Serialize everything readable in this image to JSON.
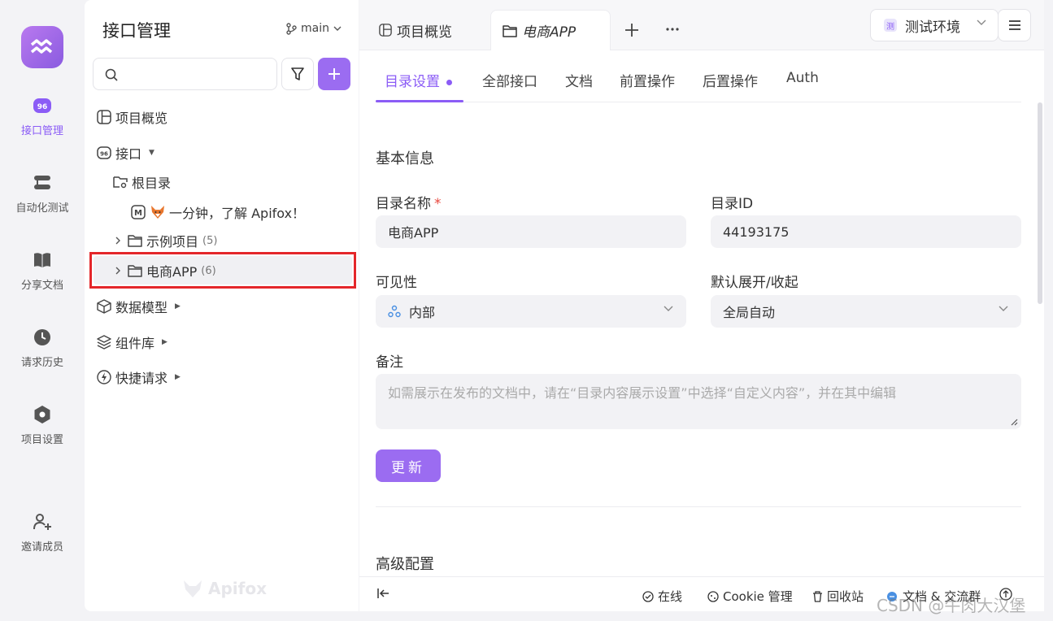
{
  "app": {
    "logo_icon": "aquarius-logo-icon",
    "brand_color": "#8b5cf6"
  },
  "rail": {
    "items": [
      {
        "label": "接口管理",
        "icon": "api-icon",
        "active": true
      },
      {
        "label": "自动化测试",
        "icon": "automation-icon"
      },
      {
        "label": "分享文档",
        "icon": "book-icon"
      },
      {
        "label": "请求历史",
        "icon": "clock-icon"
      },
      {
        "label": "项目设置",
        "icon": "hexagon-settings-icon"
      }
    ],
    "invite_label": "邀请成员"
  },
  "left_panel": {
    "title": "接口管理",
    "branch": "main",
    "search_placeholder": "",
    "tree": {
      "overview": "项目概览",
      "api": "接口",
      "root": "根目录",
      "intro_doc": "一分钟，了解 Apifox！",
      "sample_project": {
        "label": "示例项目",
        "count": "(5)"
      },
      "ecommerce": {
        "label": "电商APP",
        "count": "(6)"
      },
      "schemas": "数据模型",
      "components": "组件库",
      "quick_requests": "快捷请求"
    },
    "watermark_logo": "Apifox"
  },
  "main": {
    "tabs": [
      {
        "label": "项目概览"
      },
      {
        "label": "电商APP",
        "active": true
      }
    ],
    "env": {
      "label": "测试环境",
      "badge": "测"
    },
    "subtabs": [
      "目录设置",
      "全部接口",
      "文档",
      "前置操作",
      "后置操作",
      "Auth"
    ],
    "form": {
      "basic_title": "基本信息",
      "name_label": "目录名称",
      "required_mark": "*",
      "name_value": "电商APP",
      "id_label": "目录ID",
      "id_value": "44193175",
      "visibility_label": "可见性",
      "visibility_value": "内部",
      "expand_label": "默认展开/收起",
      "expand_value": "全局自动",
      "note_label": "备注",
      "note_placeholder": "如需展示在发布的文档中，请在“目录内容展示设置”中选择“自定义内容”，并在其中编辑",
      "update_button": "更新",
      "advanced_title": "高级配置"
    },
    "statusbar": {
      "online": "在线",
      "cookie": "Cookie 管理",
      "trash": "回收站",
      "community": "文档 & 交流群"
    }
  },
  "overlay_watermark": "CSDN @牛肉大汉堡"
}
